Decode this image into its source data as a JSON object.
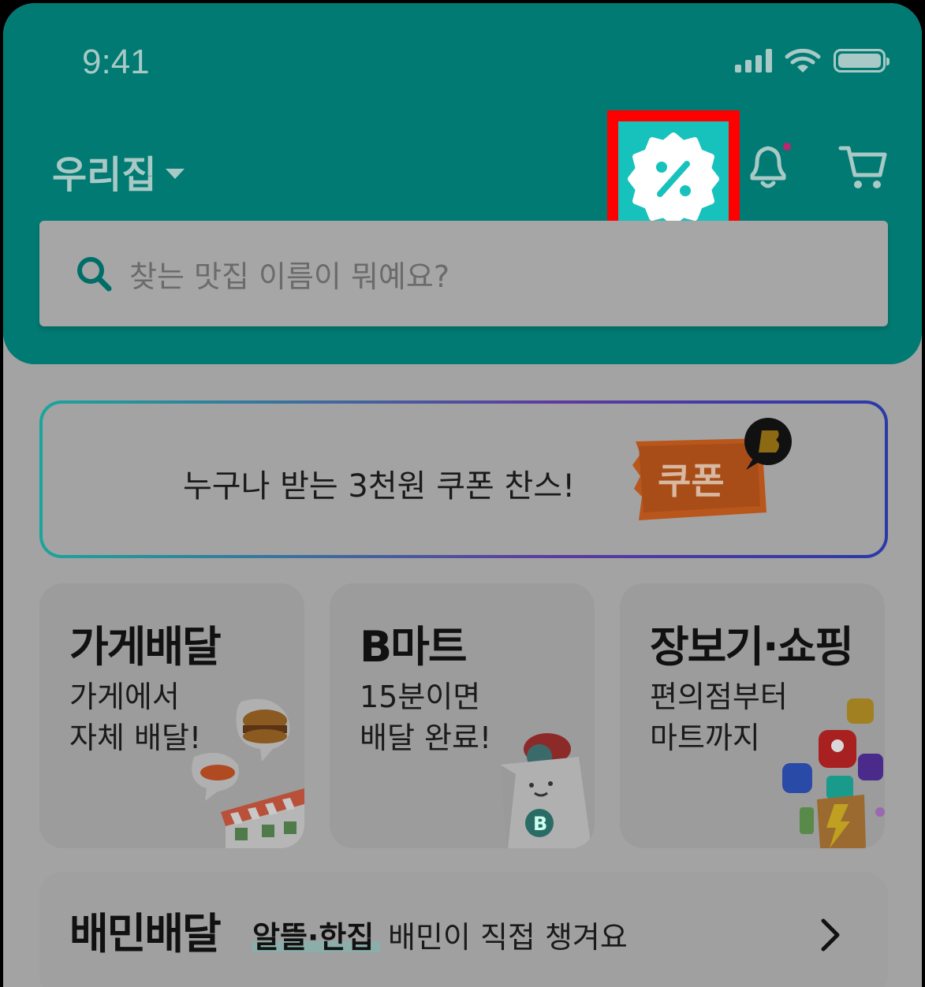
{
  "status_bar": {
    "time": "9:41"
  },
  "header": {
    "location_label": "우리집",
    "search_placeholder": "찾는 맛집 이름이 뭐예요?"
  },
  "promo": {
    "text": "누구나 받는 3천원 쿠폰 찬스!",
    "badge": "쿠폰"
  },
  "cards": [
    {
      "title": "가게배달",
      "subtitle": "가게에서\n자체 배달!"
    },
    {
      "title": "B마트",
      "subtitle": "15분이면\n배달 완료!"
    },
    {
      "title": "장보기·쇼핑",
      "subtitle": "편의점부터\n마트까지"
    }
  ],
  "baemin_delivery": {
    "title": "배민배달",
    "tag": "알뜰·한집",
    "text": "배민이 직접 챙겨요"
  },
  "colors": {
    "header": "#007a72",
    "coupon_icon_bg": "#17c2bc",
    "highlight": "#ff0000"
  }
}
